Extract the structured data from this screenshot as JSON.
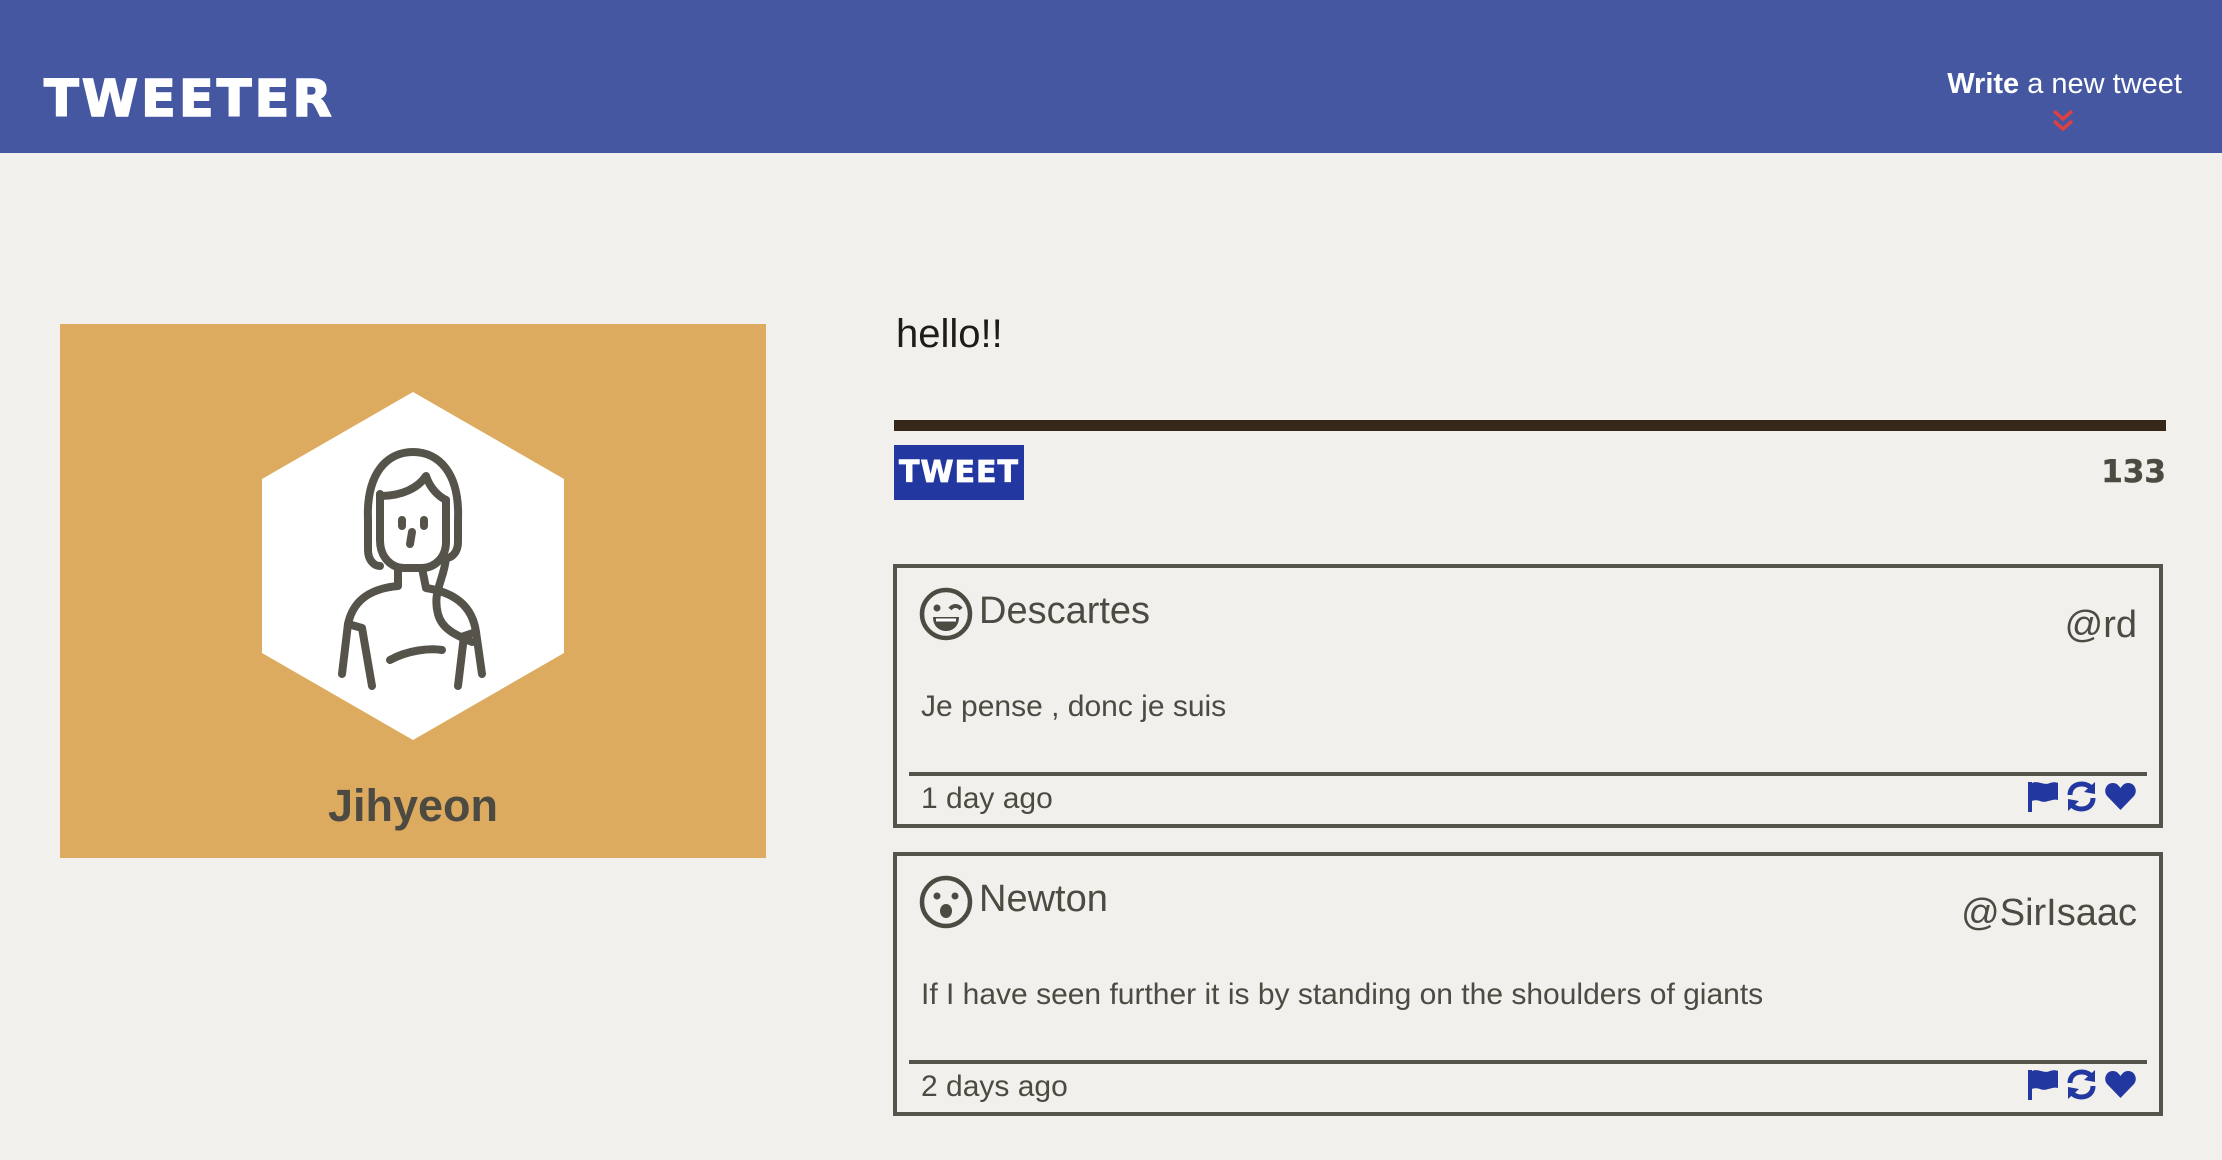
{
  "nav": {
    "brand": "TWEETER",
    "compose_bold": "Write",
    "compose_rest": " a new tweet",
    "chevron_icon": "double-chevron-down-icon",
    "colors": {
      "background": "#4557a0",
      "chevron": "#e04040"
    }
  },
  "profile": {
    "avatar_icon": "woman-avatar-icon",
    "username": "Jihyeon",
    "colors": {
      "card": "#ddab5f"
    }
  },
  "composer": {
    "text": "hello!!",
    "button_label": "TWEET",
    "char_count": "133",
    "colors": {
      "button": "#2238a0",
      "underline": "#362819"
    }
  },
  "tweets": [
    {
      "face_icon": "winking-face-icon",
      "name": "Descartes",
      "handle": "@rd",
      "content": "Je pense , donc je suis",
      "time": "1 day ago",
      "actions": [
        "flag-icon",
        "retweet-icon",
        "heart-icon"
      ]
    },
    {
      "face_icon": "surprised-face-icon",
      "name": "Newton",
      "handle": "@SirIsaac",
      "content": "If I have seen further it is by standing on the shoulders of giants",
      "time": "2 days ago",
      "actions": [
        "flag-icon",
        "retweet-icon",
        "heart-icon"
      ]
    }
  ],
  "colors": {
    "page_background": "#f2f0ec",
    "text": "#4d4a42",
    "action_icons": "#2238a0"
  }
}
